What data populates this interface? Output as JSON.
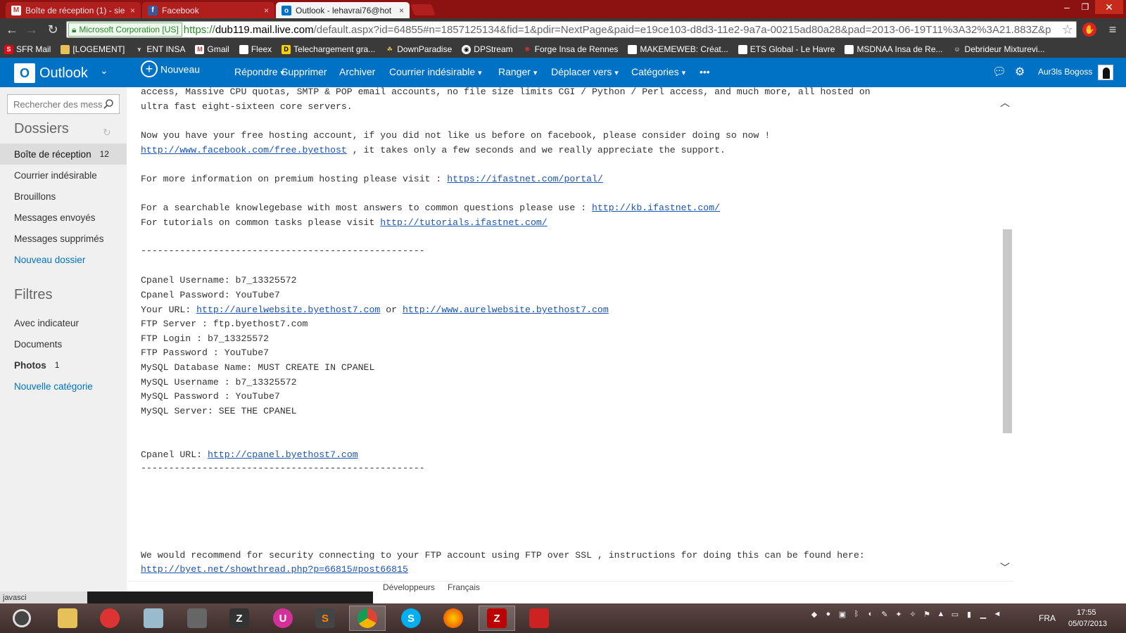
{
  "browser": {
    "tabs": [
      {
        "title": "Boîte de réception (1) - sie",
        "icon": "gmail-icon"
      },
      {
        "title": "Facebook",
        "icon": "facebook-icon"
      },
      {
        "title": "Outlook - lehavrai76@hot",
        "icon": "outlook-icon",
        "active": true
      }
    ],
    "tab_close": "×",
    "ev_label": "Microsoft Corporation [US]",
    "url_scheme": "https://",
    "url_host": "dub119.mail.live.com",
    "url_rest": "/default.aspx?id=64855#n=1857125134&fid=1&pdir=NextPage&paid=e19ce103-d8d3-11e2-9a7a-00215ad80a28&pad=2013-06-19T11%3A32%3A21.883Z&p",
    "bookmarks": [
      {
        "label": "SFR Mail",
        "icon": "sfr-icon"
      },
      {
        "label": "[LOGEMENT]",
        "icon": "folder-icon"
      },
      {
        "label": "ENT INSA",
        "icon": "ent-icon"
      },
      {
        "label": "Gmail",
        "icon": "gmail-icon"
      },
      {
        "label": "Fleex",
        "icon": "page-icon"
      },
      {
        "label": "Telechargement gra...",
        "icon": "dl-icon"
      },
      {
        "label": "DownParadise",
        "icon": "downparadise-icon"
      },
      {
        "label": "DPStream",
        "icon": "dpstream-icon"
      },
      {
        "label": "Forge Insa de Rennes",
        "icon": "forge-icon"
      },
      {
        "label": "MAKEMEWEB: Créat...",
        "icon": "page-icon"
      },
      {
        "label": "ETS Global - Le Havre",
        "icon": "page-icon"
      },
      {
        "label": "MSDNAA Insa de Re...",
        "icon": "page-icon"
      },
      {
        "label": "Debrideur Mixturevi...",
        "icon": "debrideur-icon"
      }
    ]
  },
  "outlook": {
    "brand": "Outlook",
    "commands": {
      "new": "Nouveau",
      "reply": "Répondre",
      "delete": "Supprimer",
      "archive": "Archiver",
      "junk": "Courrier indésirable",
      "sweep": "Ranger",
      "move": "Déplacer vers",
      "categories": "Catégories",
      "more": "•••"
    },
    "user_name": "Aur3ls Bogoss"
  },
  "sidebar": {
    "search_placeholder": "Rechercher des messages",
    "folders_title": "Dossiers",
    "folders": [
      {
        "label": "Boîte de réception",
        "count": "12"
      },
      {
        "label": "Courrier indésirable"
      },
      {
        "label": "Brouillons"
      },
      {
        "label": "Messages envoyés"
      },
      {
        "label": "Messages supprimés"
      },
      {
        "label": "Nouveau dossier"
      }
    ],
    "filters_title": "Filtres",
    "filters": [
      {
        "label": "Avec indicateur"
      },
      {
        "label": "Documents"
      },
      {
        "label": "Photos",
        "count": "1"
      },
      {
        "label": "Nouvelle catégorie"
      }
    ]
  },
  "email": {
    "line1": "access, Massive CPU quotas, SMTP & POP email accounts, no file size limits CGI / Python / Perl access, and much more, all hosted on",
    "line2": "ultra fast eight-sixteen core servers.",
    "line3": "Now you have your free hosting account, if you did not like us before on facebook, please consider doing so now !",
    "fb_link": "http://www.facebook.com/free.byethost",
    "line4_suffix": " , it takes only a few seconds and we really appreciate the support.",
    "premium_prefix": "For more information on premium hosting please visit : ",
    "premium_link": "https://ifastnet.com/portal/",
    "kb_prefix": "For a searchable knowlegebase with most answers to common questions please use : ",
    "kb_link": "http://kb.ifastnet.com/",
    "tut_prefix": "For tutorials on common tasks please visit ",
    "tut_link": "http://tutorials.ifastnet.com/",
    "divider": "---------------------------------------------------",
    "cpanel_user": "Cpanel Username: b7_13325572",
    "cpanel_pass": "Cpanel Password: YouTube7",
    "url_prefix": "Your URL: ",
    "url_link1": "http://aurelwebsite.byethost7.com",
    "url_or": " or ",
    "url_link2": "http://www.aurelwebsite.byethost7.com",
    "ftp_server": "FTP Server : ftp.byethost7.com",
    "ftp_login": "FTP Login : b7_13325572",
    "ftp_pass": "FTP Password : YouTube7",
    "mysql_db": "MySQL Database Name: MUST CREATE IN CPANEL",
    "mysql_user": "MySQL Username : b7_13325572",
    "mysql_pass": "MySQL Password : YouTube7",
    "mysql_server": "MySQL Server: SEE THE CPANEL",
    "cpanel_url_prefix": "Cpanel URL: ",
    "cpanel_url_link": "http://cpanel.byethost7.com",
    "security_line": "We would recommend for security connecting to your FTP account using FTP over SSL , instructions for doing this can be found here:",
    "security_link": "http://byet.net/showthread.php?p=66815#post66815"
  },
  "footer": {
    "developers": "Développeurs",
    "language": "Français",
    "status_url": "javasci"
  },
  "taskbar": {
    "lang": "FRA",
    "time": "17:55",
    "date": "05/07/2013"
  }
}
